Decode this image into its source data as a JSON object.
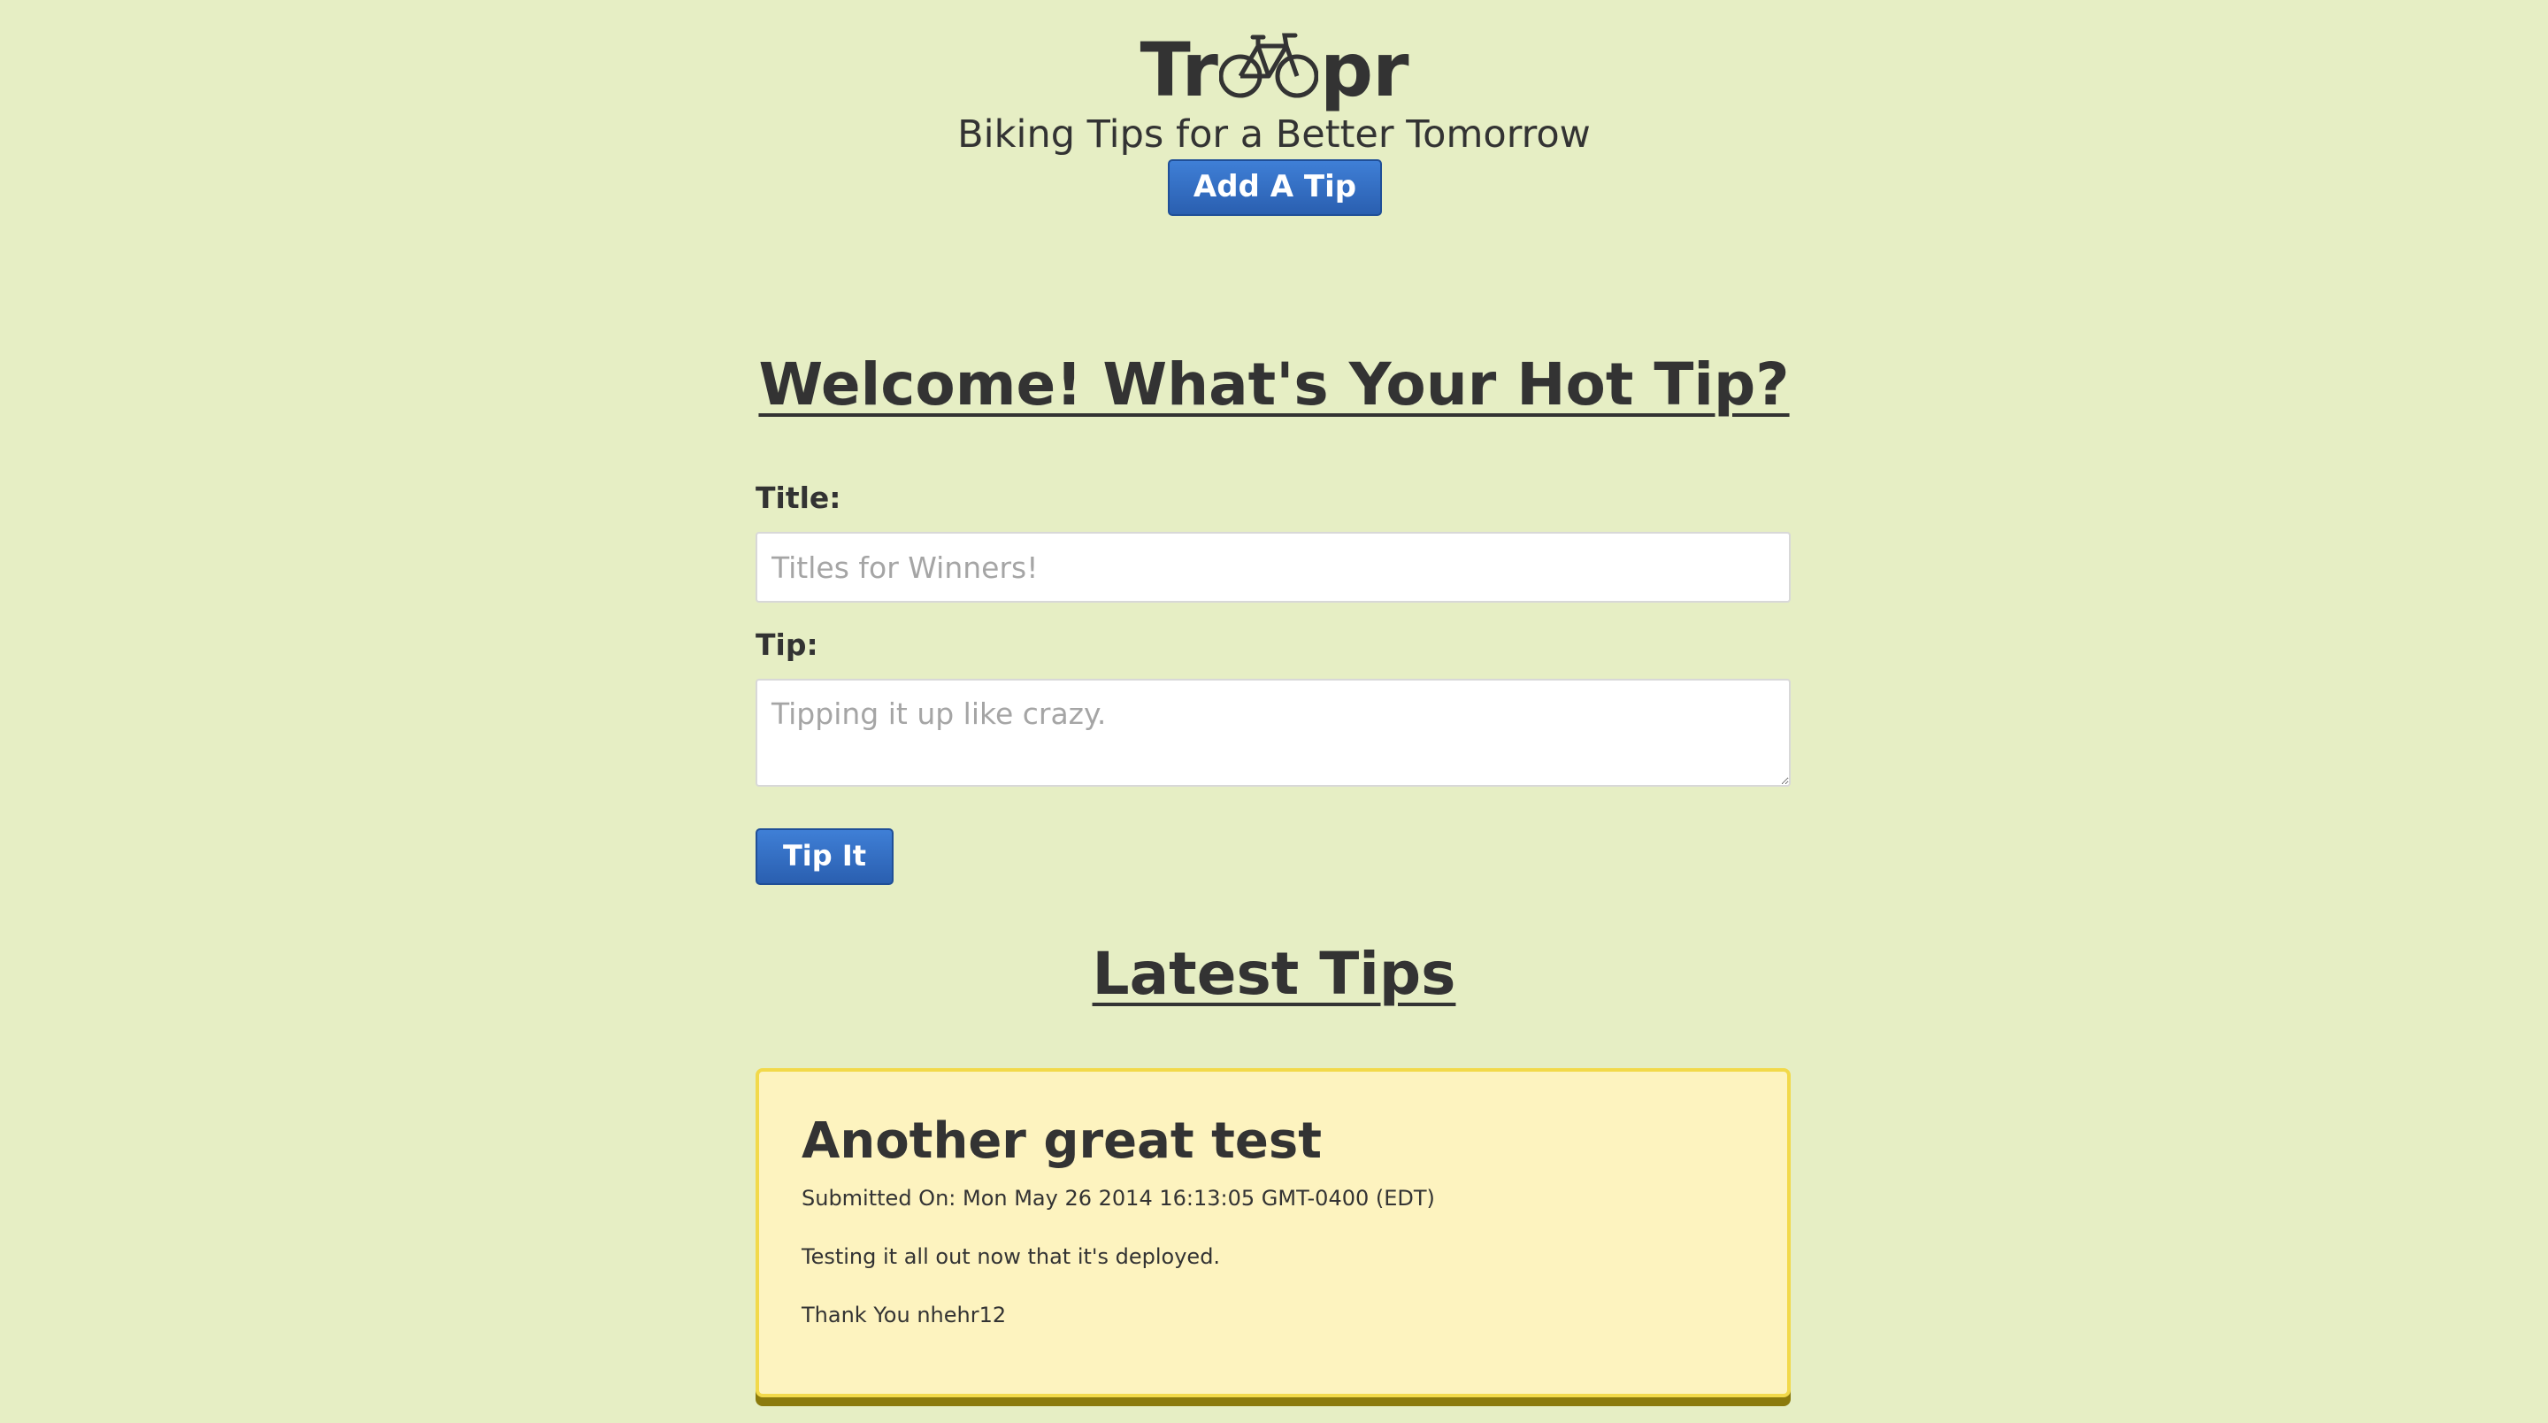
{
  "header": {
    "logo_prefix": "Tr",
    "logo_suffix": "pr",
    "logo_icon": "bicycle-icon",
    "tagline": "Biking Tips for a Better Tomorrow",
    "add_tip_label": "Add A Tip"
  },
  "form": {
    "heading": "Welcome! What's Your Hot Tip?",
    "title_label": "Title:",
    "title_placeholder": "Titles for Winners!",
    "title_value": "",
    "tip_label": "Tip:",
    "tip_placeholder": "Tipping it up like crazy.",
    "tip_value": "",
    "submit_label": "Tip It"
  },
  "latest": {
    "heading": "Latest Tips",
    "tips": [
      {
        "title": "Another great test",
        "submitted": "Submitted On: Mon May 26 2014 16:13:05 GMT-0400 (EDT)",
        "body": "Testing it all out now that it's deployed.",
        "signature": "Thank You nhehr12"
      }
    ]
  },
  "colors": {
    "background": "#e6eec4",
    "button": "#2f6bc2",
    "card_background": "#fdf3bf",
    "card_border": "#f2d94a",
    "text": "#333333"
  }
}
